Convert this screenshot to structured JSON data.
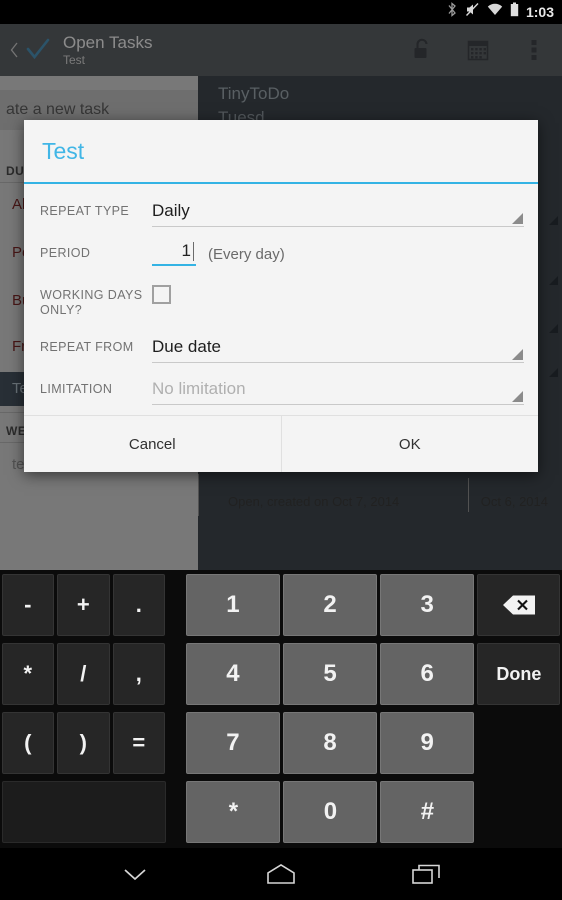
{
  "statusbar": {
    "time": "1:03",
    "icons": [
      "bluetooth-icon",
      "volume-mute-icon",
      "wifi-icon",
      "battery-icon"
    ]
  },
  "actionbar": {
    "back_icon": "back-chevron-icon",
    "logo_icon": "checkmark-logo-icon",
    "title": "Open Tasks",
    "subtitle": "Test",
    "actions": [
      {
        "name": "unlock-icon",
        "label": "Unlock"
      },
      {
        "name": "calendar-icon",
        "label": "Calendar"
      },
      {
        "name": "overflow-menu-icon",
        "label": "More options"
      }
    ]
  },
  "background": {
    "new_task_label": "ate a new task",
    "app_title": "TinyToDo",
    "app_subtitle": "Tuesd",
    "section_due": "DUE",
    "section_week": "WEE",
    "tasks": [
      {
        "label": "Ab"
      },
      {
        "label": "Pe"
      },
      {
        "label": "Bu"
      },
      {
        "label": "Fri"
      }
    ],
    "selected_task": "Te",
    "below_week_task": "tes",
    "detail_status": "Open, created on Oct 7, 2014",
    "detail_date": "Oct 6, 2014"
  },
  "dialog": {
    "title": "Test",
    "fields": [
      {
        "label": "REPEAT TYPE",
        "type": "spinner",
        "value": "Daily",
        "is_hint": false
      },
      {
        "label": "PERIOD",
        "type": "number",
        "value": "1",
        "note": "(Every day)"
      },
      {
        "label": "WORKING DAYS ONLY?",
        "type": "checkbox",
        "checked": false
      },
      {
        "label": "REPEAT FROM",
        "type": "spinner",
        "value": "Due date",
        "is_hint": false
      },
      {
        "label": "LIMITATION",
        "type": "spinner",
        "value": "No limitation",
        "is_hint": true
      }
    ],
    "cancel_label": "Cancel",
    "ok_label": "OK",
    "accent_color": "#34b3e4"
  },
  "keyboard": {
    "rows": [
      [
        {
          "label": "-",
          "kind": "sym"
        },
        {
          "label": "+",
          "kind": "sym"
        },
        {
          "label": ".",
          "kind": "sym"
        },
        {
          "label": "1",
          "kind": "num"
        },
        {
          "label": "2",
          "kind": "num"
        },
        {
          "label": "3",
          "kind": "num"
        },
        {
          "label": "backspace-icon",
          "kind": "side-icon"
        }
      ],
      [
        {
          "label": "*",
          "kind": "sym"
        },
        {
          "label": "/",
          "kind": "sym"
        },
        {
          "label": ",",
          "kind": "sym"
        },
        {
          "label": "4",
          "kind": "num"
        },
        {
          "label": "5",
          "kind": "num"
        },
        {
          "label": "6",
          "kind": "num"
        },
        {
          "label": "Done",
          "kind": "side"
        }
      ],
      [
        {
          "label": "(",
          "kind": "sym"
        },
        {
          "label": ")",
          "kind": "sym"
        },
        {
          "label": "=",
          "kind": "sym"
        },
        {
          "label": "7",
          "kind": "num"
        },
        {
          "label": "8",
          "kind": "num"
        },
        {
          "label": "9",
          "kind": "num"
        }
      ],
      [
        {
          "label": "",
          "kind": "wide"
        },
        {
          "label": "*",
          "kind": "num"
        },
        {
          "label": "0",
          "kind": "num"
        },
        {
          "label": "#",
          "kind": "num"
        }
      ]
    ]
  },
  "navbar": {
    "buttons": [
      {
        "name": "hide-keyboard-icon",
        "label": "Hide keyboard"
      },
      {
        "name": "home-icon",
        "label": "Home"
      },
      {
        "name": "recents-icon",
        "label": "Recent apps"
      }
    ]
  }
}
